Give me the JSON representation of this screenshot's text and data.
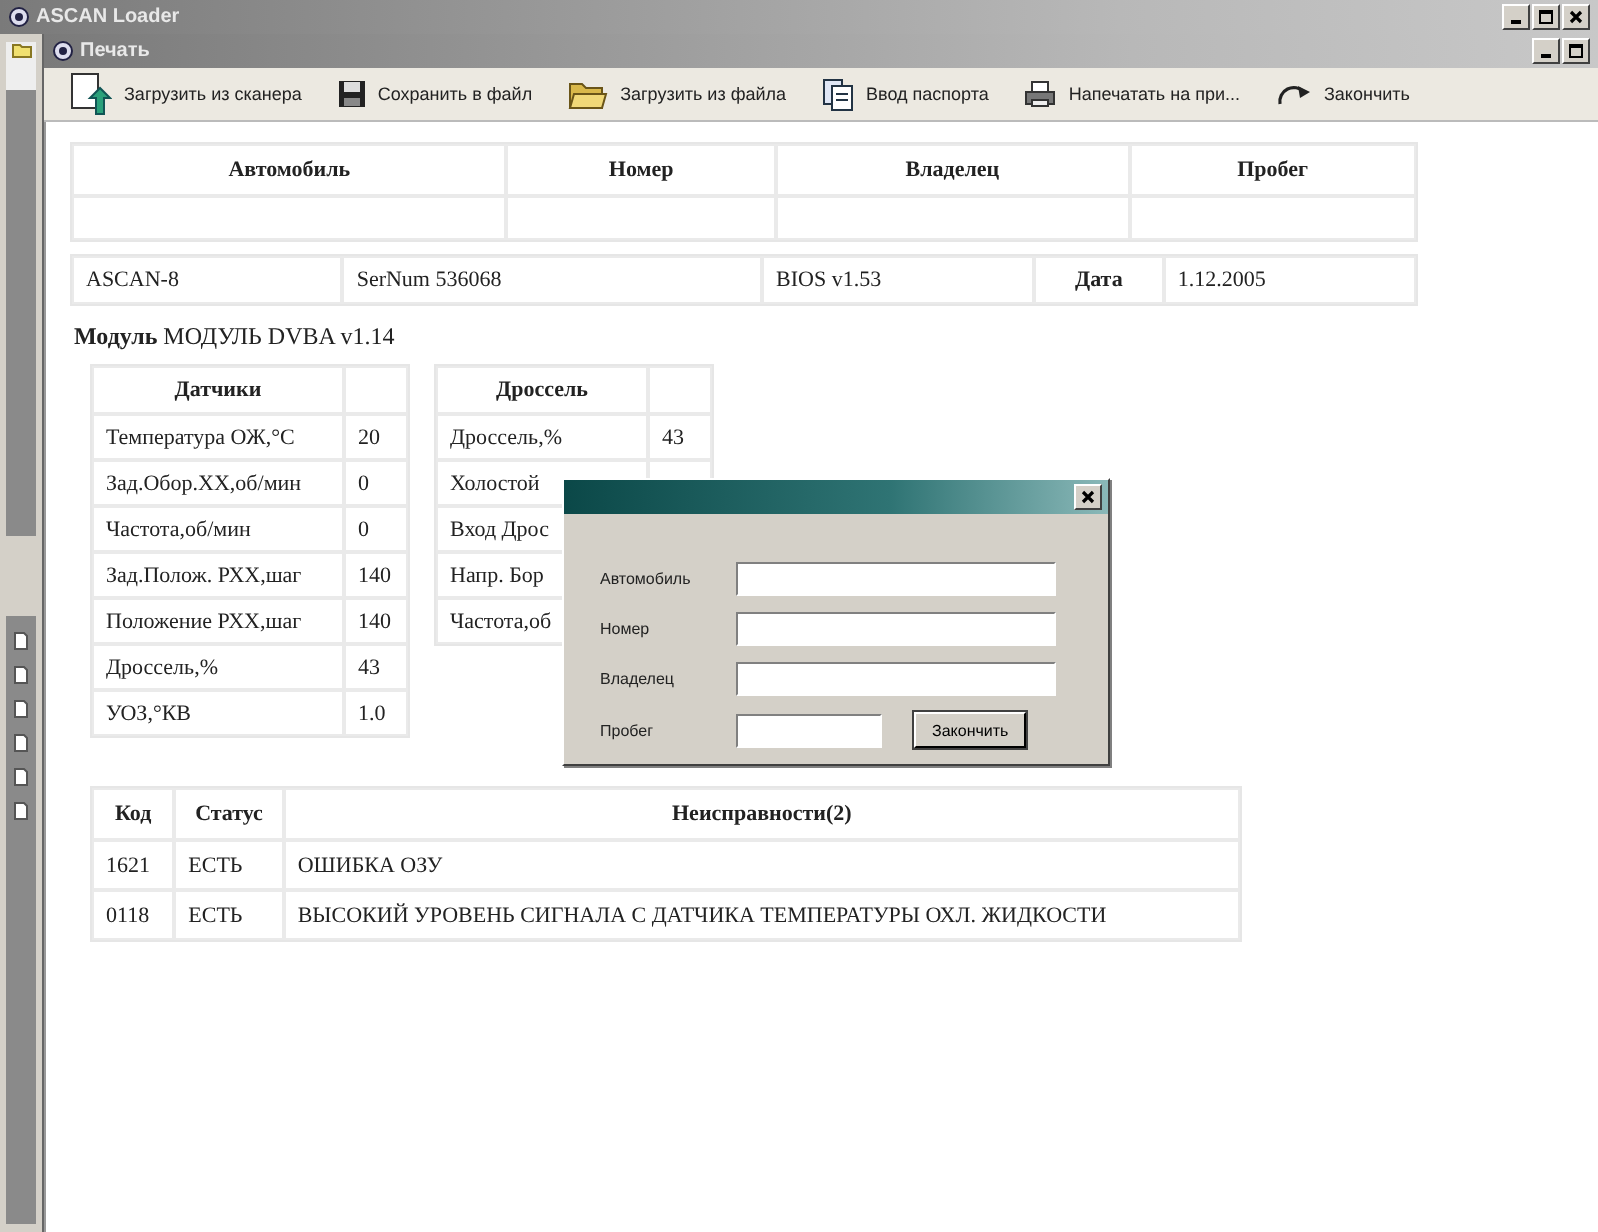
{
  "window": {
    "title": "ASCAN Loader"
  },
  "child_window": {
    "title": "Печать"
  },
  "toolbar": [
    {
      "label": "Загрузить из сканера",
      "kind": "scan"
    },
    {
      "label": "Сохранить в файл",
      "kind": "save"
    },
    {
      "label": "Загрузить из файла",
      "kind": "open"
    },
    {
      "label": "Ввод паспорта",
      "kind": "passport"
    },
    {
      "label": "Напечатать на при...",
      "kind": "print"
    },
    {
      "label": "Закончить",
      "kind": "finish"
    }
  ],
  "vehicle_table": {
    "columns": [
      "Автомобиль",
      "Номер",
      "Владелец",
      "Пробег"
    ]
  },
  "device": [
    {
      "text": "ASCAN-8",
      "kind": "value"
    },
    {
      "text": "SerNum 536068",
      "kind": "value"
    },
    {
      "text": "BIOS v1.53",
      "kind": "value"
    },
    {
      "text": "Дата",
      "kind": "label"
    },
    {
      "text": "1.12.2005",
      "kind": "value"
    }
  ],
  "module": "**Модуль** МОДУЛЬ DVBA v1.14",
  "sensors": {
    "title": "Датчики",
    "rows": [
      {
        "name": "Температура ОЖ,°С",
        "value": "20"
      },
      {
        "name": "Зад.Обор.ХХ,об/мин",
        "value": "0"
      },
      {
        "name": "Частота,об/мин",
        "value": "0"
      },
      {
        "name": "Зад.Полож. РХХ,шаг",
        "value": "140"
      },
      {
        "name": "Положение РХХ,шаг",
        "value": "140"
      },
      {
        "name": "Дроссель,%",
        "value": "43"
      },
      {
        "name": "УОЗ,°КВ",
        "value": "1.0"
      }
    ]
  },
  "throttle": {
    "title": "Дроссель",
    "rows": [
      {
        "name": "Дроссель,%",
        "value": "43"
      },
      {
        "name": "Холостой"
      },
      {
        "name": "Вход Дрос"
      },
      {
        "name": "Напр. Бор"
      },
      {
        "name": "Частота,об"
      }
    ]
  },
  "faults": {
    "columns": [
      "Код",
      "Статус",
      "Неисправности(2)"
    ],
    "rows": [
      {
        "code": "1621",
        "status": "ЕСТЬ",
        "description": "ОШИБКА ОЗУ"
      },
      {
        "code": "0118",
        "status": "ЕСТЬ",
        "description": "ВЫСОКИЙ УРОВЕНЬ СИГНАЛА С ДАТЧИКА ТЕМПЕРАТУРЫ ОХЛ. ЖИДКОСТИ"
      }
    ]
  },
  "dialog": {
    "fields": [
      {
        "label": "Автомобиль"
      },
      {
        "label": "Номер"
      },
      {
        "label": "Владелец"
      },
      {
        "label": "Пробег"
      }
    ],
    "button": "Закончить"
  }
}
